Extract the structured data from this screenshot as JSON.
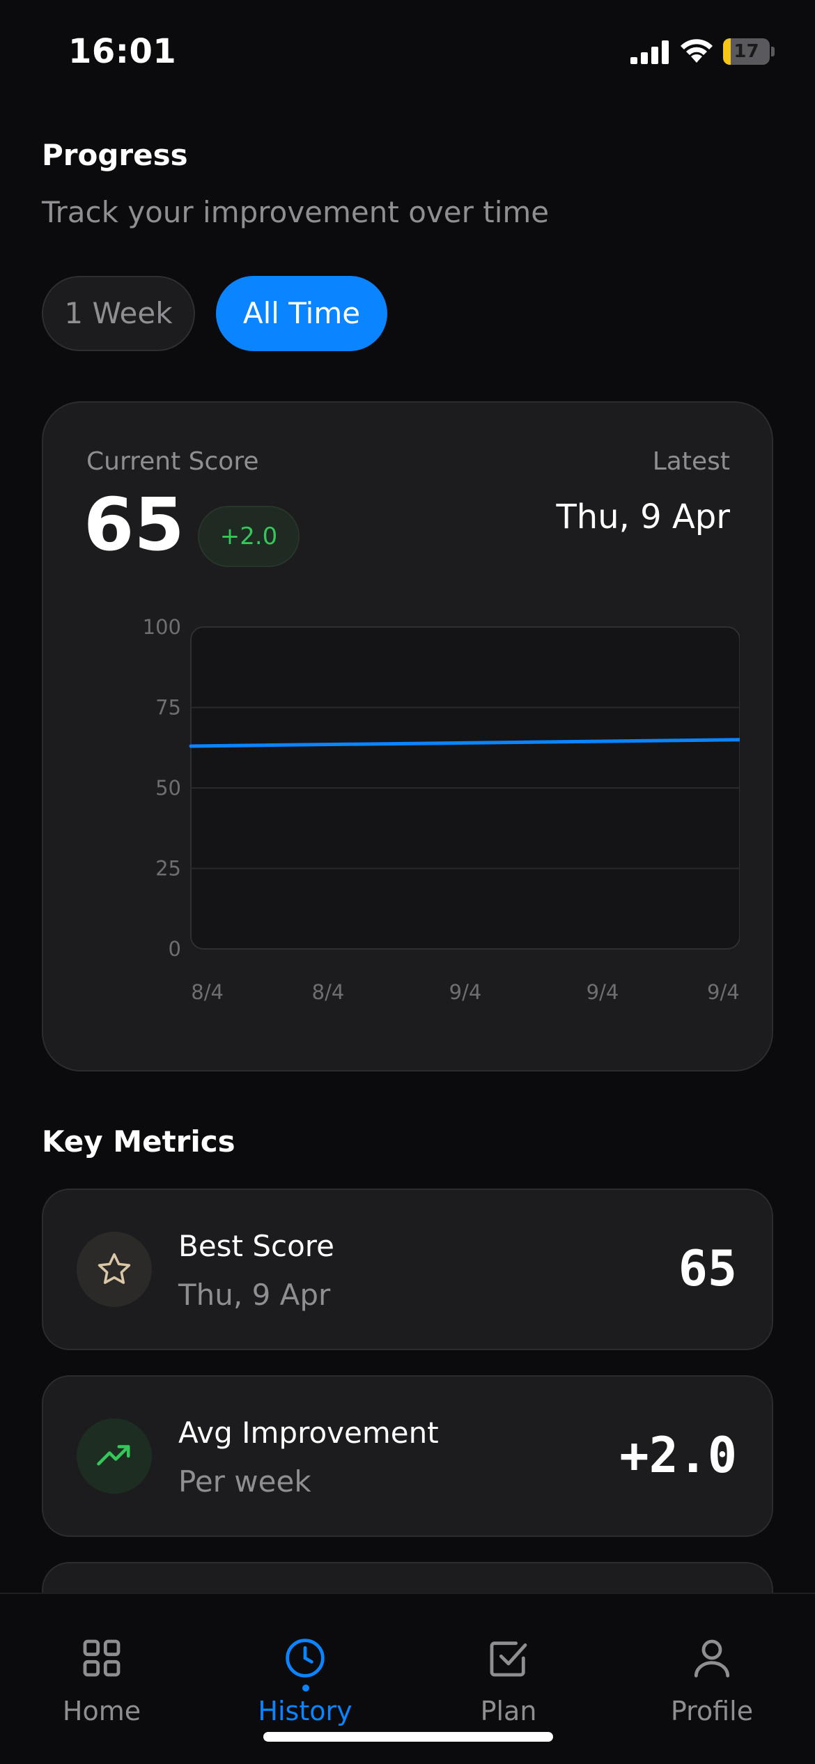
{
  "status_bar": {
    "time": "16:01",
    "battery_level": "17",
    "battery_fraction": 0.17
  },
  "header": {
    "title": "Progress",
    "subtitle": "Track your improvement over time"
  },
  "range": {
    "options": [
      "1 Week",
      "All Time"
    ],
    "selected": "All Time"
  },
  "score_card": {
    "current_label": "Current Score",
    "current_value": "65",
    "delta": "+2.0",
    "latest_label": "Latest",
    "latest_date": "Thu, 9 Apr"
  },
  "chart_data": {
    "type": "line",
    "x_tick_labels": [
      "8/4",
      "8/4",
      "9/4",
      "9/4",
      "9/4"
    ],
    "y_ticks": [
      100,
      75,
      50,
      25,
      0
    ],
    "ylim": [
      0,
      100
    ],
    "series": [
      {
        "values": [
          63,
          65
        ],
        "color": "#0a84ff"
      }
    ],
    "grid": true
  },
  "key_metrics": {
    "title": "Key Metrics",
    "items": [
      {
        "title": "Best Score",
        "subtitle": "Thu, 9 Apr",
        "value": "65",
        "icon": "star-icon"
      },
      {
        "title": "Avg Improvement",
        "subtitle": "Per week",
        "value": "+2.0",
        "icon": "trending-up-icon"
      }
    ]
  },
  "tab_bar": {
    "tabs": [
      {
        "label": "Home",
        "icon": "grid-icon"
      },
      {
        "label": "History",
        "icon": "clock-icon"
      },
      {
        "label": "Plan",
        "icon": "checkbox-icon"
      },
      {
        "label": "Profile",
        "icon": "person-icon"
      }
    ],
    "active": "History"
  },
  "colors": {
    "accent": "#0a84ff",
    "positive": "#34c759",
    "star": "#d9c7a7",
    "background": "#0b0b0d",
    "card": "#1c1c1f"
  }
}
